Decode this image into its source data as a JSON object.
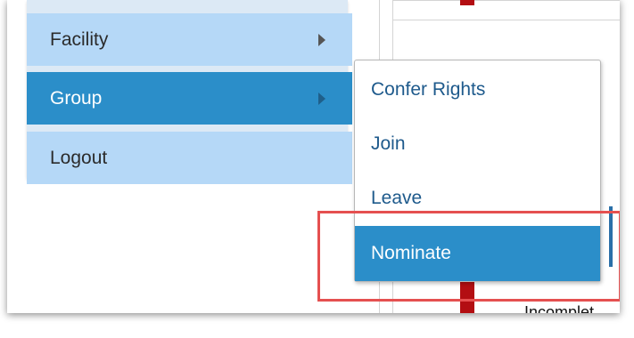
{
  "sidebar": {
    "items": [
      {
        "label": "Facility"
      },
      {
        "label": "Group"
      },
      {
        "label": "Logout"
      }
    ]
  },
  "submenu": {
    "items": [
      {
        "label": "Confer Rights"
      },
      {
        "label": "Join"
      },
      {
        "label": "Leave"
      },
      {
        "label": "Nominate"
      }
    ]
  },
  "background": {
    "status_text": "Incomplet"
  },
  "colors": {
    "menu_light": "#b5d8f7",
    "menu_active": "#2b8ec9",
    "submenu_text": "#1e5a8c",
    "highlight": "#e55050"
  }
}
